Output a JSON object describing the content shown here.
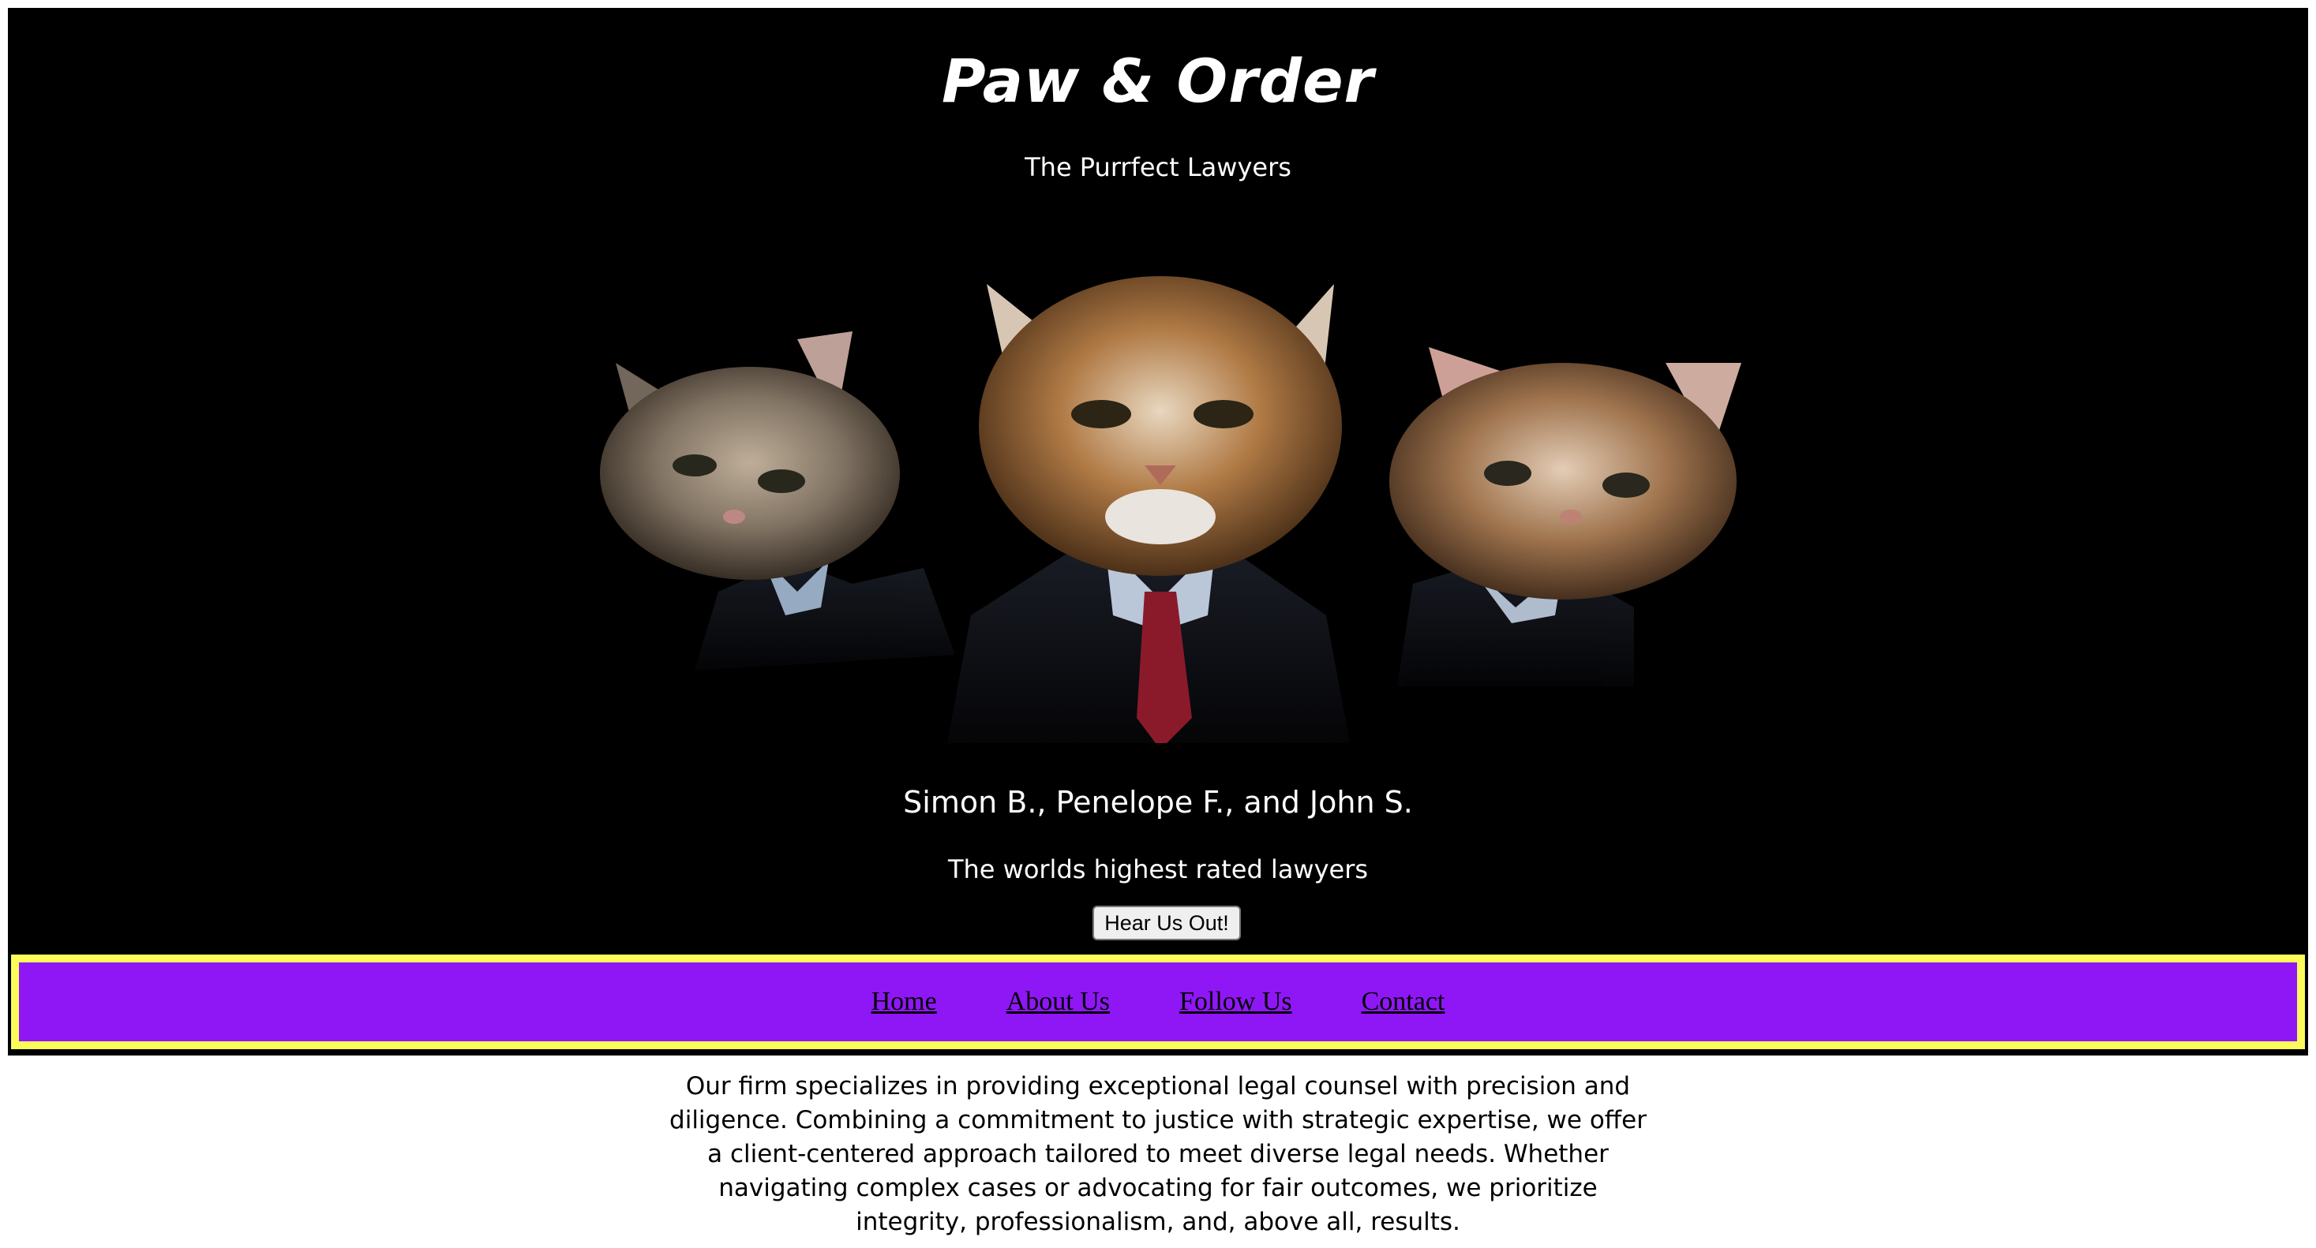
{
  "site": {
    "title": "Paw & Order",
    "tagline": "The Purrfect Lawyers"
  },
  "hero": {
    "names": "Simon B., Penelope F., and John S.",
    "subtitle": "The worlds highest rated lawyers",
    "button_label": "Hear Us Out!"
  },
  "nav": {
    "items": [
      {
        "label": "Home"
      },
      {
        "label": "About Us"
      },
      {
        "label": "Follow Us"
      },
      {
        "label": "Contact"
      }
    ]
  },
  "about": {
    "text": "Our firm specializes in providing exceptional legal counsel with precision and diligence. Combining a commitment to justice with strategic expertise, we offer a client-centered approach tailored to meet diverse legal needs. Whether navigating complex cases or advocating for fair outcomes, we prioritize integrity, professionalism, and, above all, results."
  },
  "colors": {
    "hero_background": "#000000",
    "nav_background": "#8f17f5",
    "nav_border": "#fbfb5a"
  }
}
